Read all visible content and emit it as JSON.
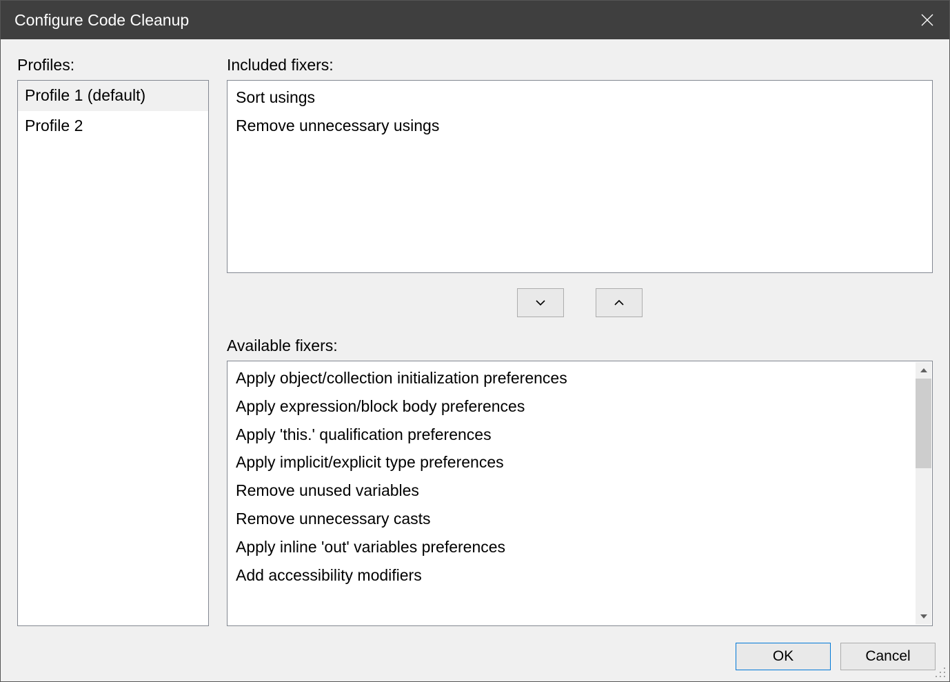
{
  "titlebar": {
    "title": "Configure Code Cleanup"
  },
  "labels": {
    "profiles": "Profiles:",
    "included": "Included fixers:",
    "available": "Available fixers:"
  },
  "profiles": [
    {
      "label": "Profile 1 (default)",
      "selected": true
    },
    {
      "label": "Profile 2",
      "selected": false
    }
  ],
  "included_fixers": [
    "Sort usings",
    "Remove unnecessary usings"
  ],
  "available_fixers": [
    "Apply object/collection initialization preferences",
    "Apply expression/block body preferences",
    "Apply 'this.' qualification preferences",
    "Apply implicit/explicit type preferences",
    "Remove unused variables",
    "Remove unnecessary casts",
    "Apply inline 'out' variables preferences",
    "Add accessibility modifiers"
  ],
  "buttons": {
    "ok": "OK",
    "cancel": "Cancel"
  }
}
